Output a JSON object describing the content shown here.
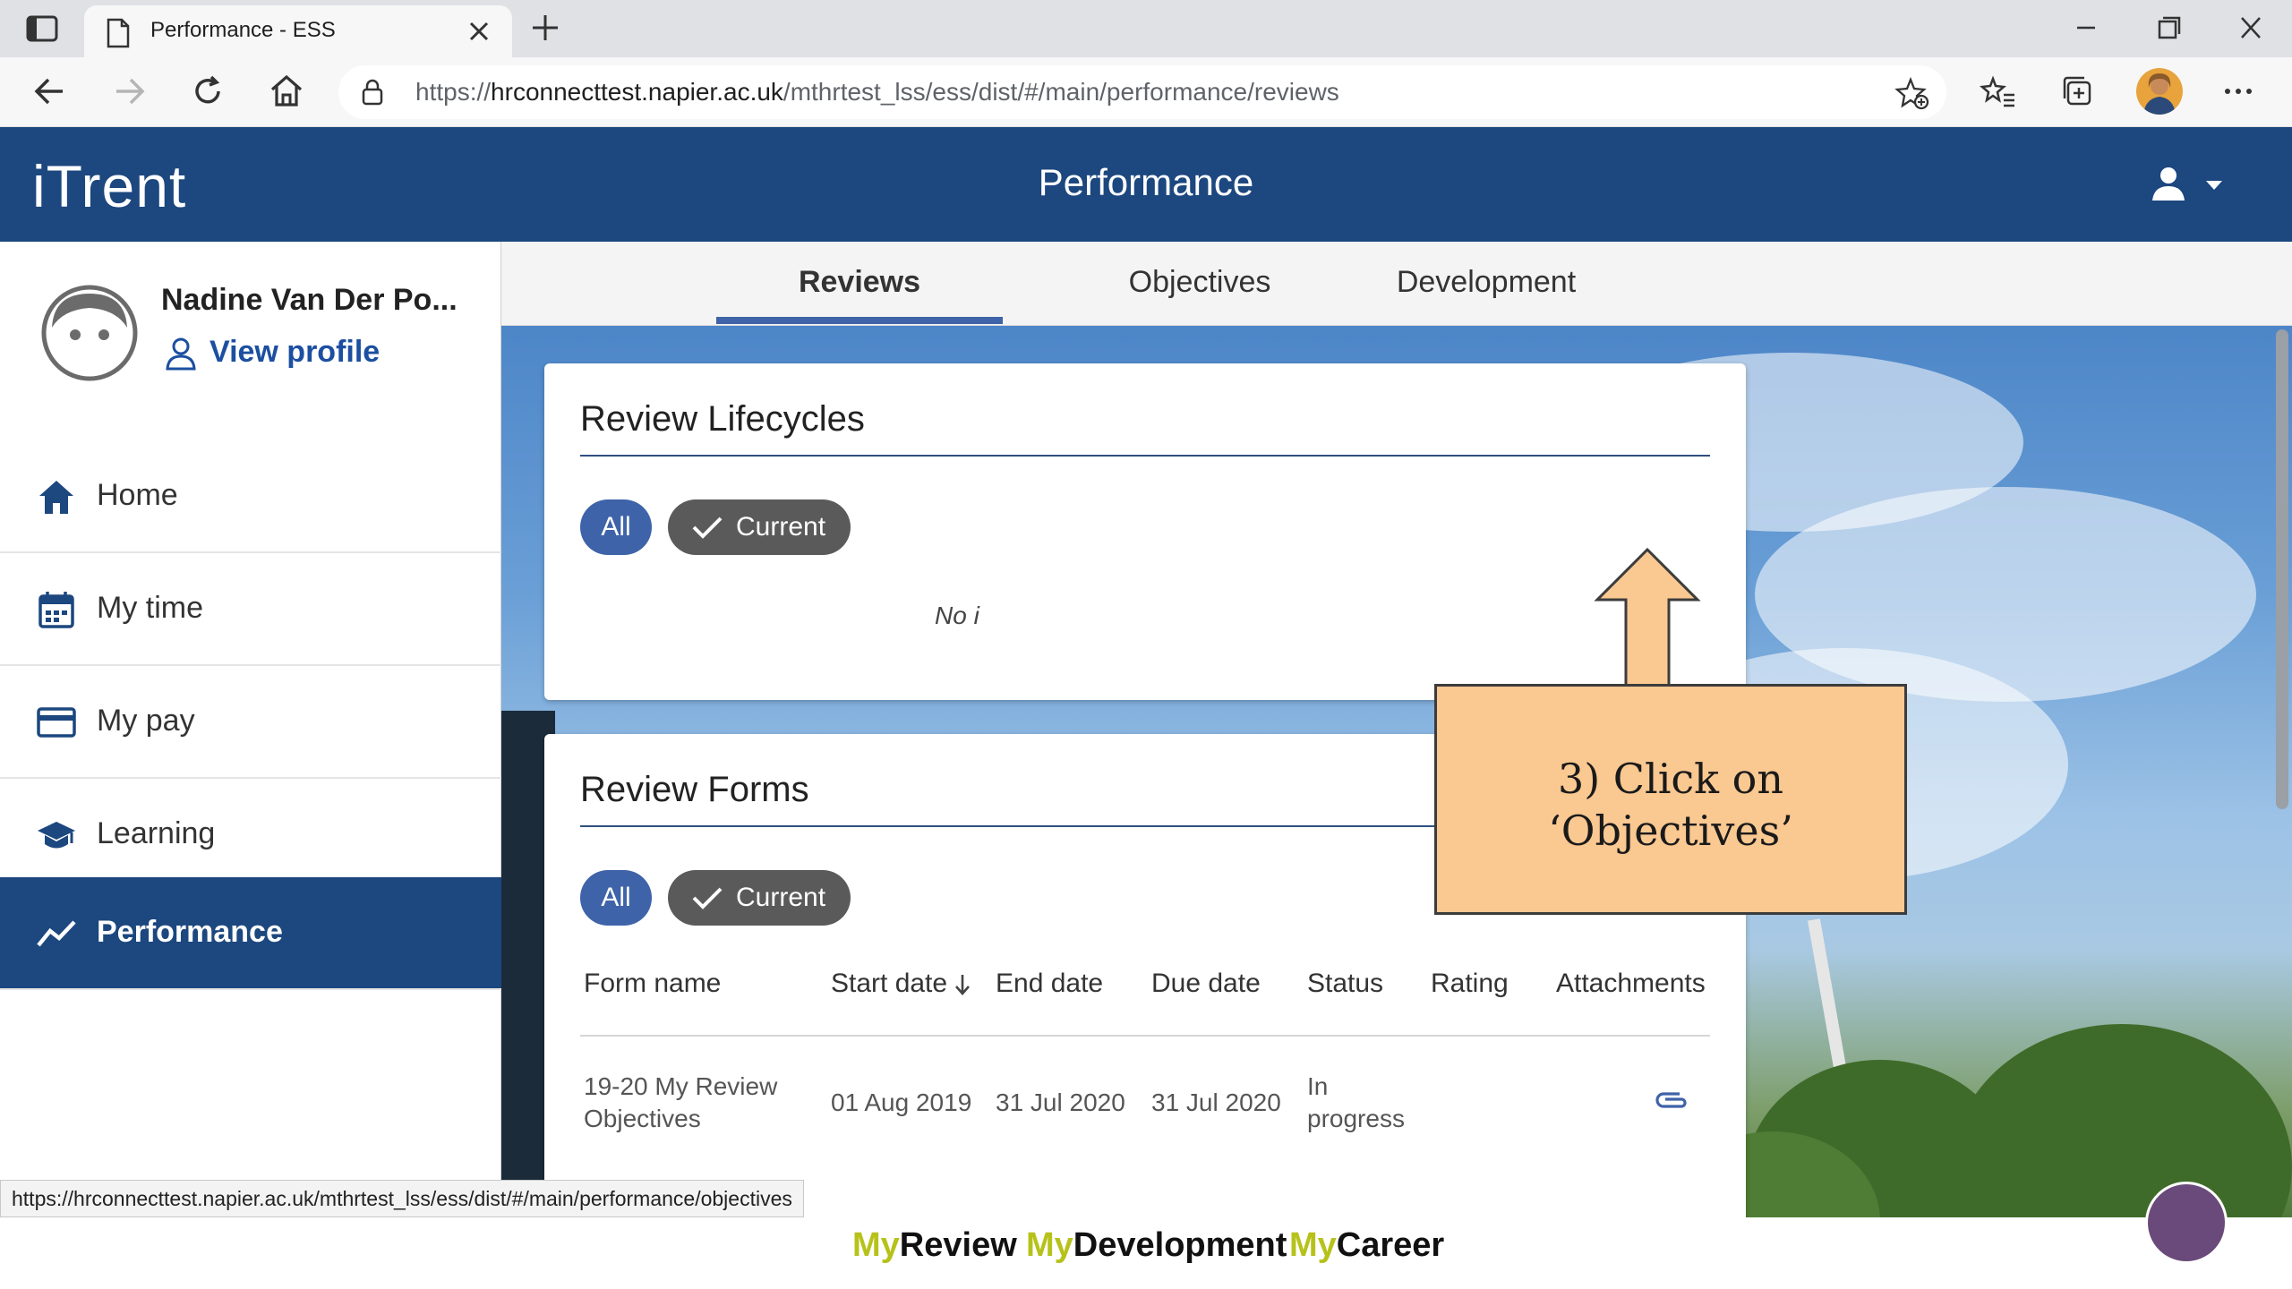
{
  "browser": {
    "tab_title": "Performance - ESS",
    "url_prefix": "https://",
    "url_host": "hrconnecttest.napier.ac.uk",
    "url_path": "/mthrtest_lss/ess/dist/#/main/performance/reviews"
  },
  "app": {
    "logo": "iTrent",
    "page_title": "Performance"
  },
  "profile": {
    "name": "Nadine Van Der Po...",
    "view_profile": "View profile"
  },
  "sidebar": {
    "items": [
      {
        "label": "Home",
        "icon": "home-icon"
      },
      {
        "label": "My time",
        "icon": "calendar-icon"
      },
      {
        "label": "My pay",
        "icon": "credit-card-icon"
      },
      {
        "label": "Learning",
        "icon": "graduation-cap-icon"
      },
      {
        "label": "Performance",
        "icon": "trend-line-icon",
        "active": true
      }
    ]
  },
  "tabs": [
    {
      "label": "Reviews",
      "active": true
    },
    {
      "label": "Objectives"
    },
    {
      "label": "Development"
    }
  ],
  "review_lifecycles": {
    "title": "Review Lifecycles",
    "filter_all": "All",
    "filter_current": "Current",
    "empty_text": "No i"
  },
  "review_forms": {
    "title": "Review Forms",
    "filter_all": "All",
    "filter_current": "Current",
    "columns": [
      "Form name",
      "Start date",
      "End date",
      "Due date",
      "Status",
      "Rating",
      "Attachments"
    ],
    "rows": [
      {
        "form_name": [
          "19-20 My Review",
          "Objectives"
        ],
        "start_date": "01 Aug 2019",
        "end_date": "31 Jul 2020",
        "due_date": "31 Jul 2020",
        "status": [
          "In",
          "progress"
        ],
        "rating": "",
        "attachment_icon": "paperclip-icon"
      }
    ]
  },
  "callout": {
    "line1": "3) Click on",
    "line2": "‘Objectives’"
  },
  "status_url": "https://hrconnecttest.napier.ac.uk/mthrtest_lss/ess/dist/#/main/performance/objectives",
  "footer": {
    "brands": [
      {
        "prefix": "My",
        "suffix": "Review"
      },
      {
        "prefix": "My",
        "suffix": "Development"
      },
      {
        "prefix": "My",
        "suffix": "Career"
      }
    ]
  },
  "colors": {
    "header_blue": "#1c477f",
    "accent_blue": "#3e63a8",
    "callout_fill": "#fac891",
    "brand_green": "#b6c21a"
  }
}
